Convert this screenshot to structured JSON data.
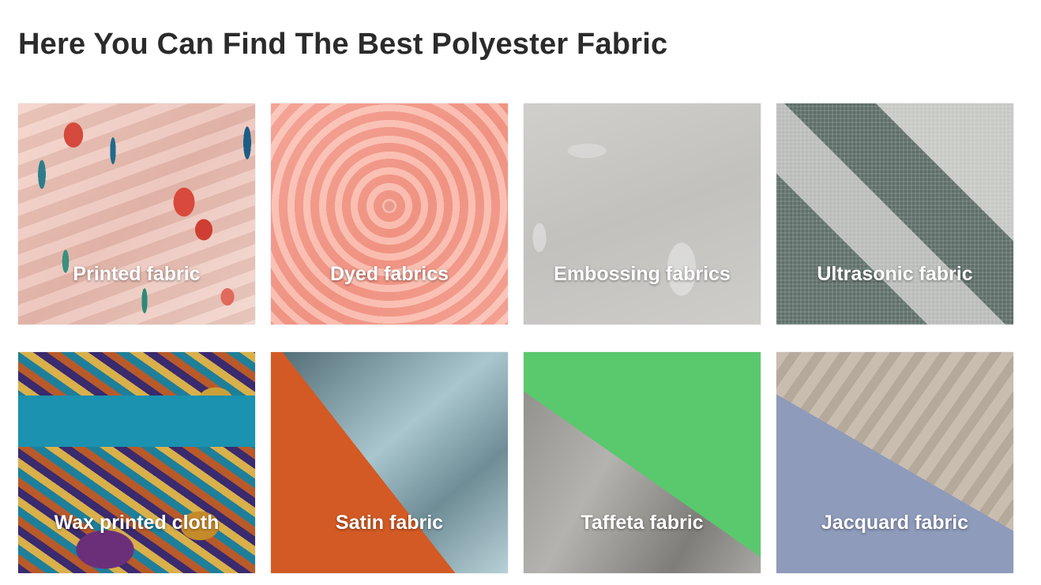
{
  "page_title": "Here You Can Find The Best Polyester Fabric",
  "fabrics": [
    {
      "label": "Printed fabric",
      "icon": "printed-fabric-photo"
    },
    {
      "label": "Dyed fabrics",
      "icon": "dyed-fabric-photo"
    },
    {
      "label": "Embossing fabrics",
      "icon": "embossing-fabric-photo"
    },
    {
      "label": "Ultrasonic fabric",
      "icon": "ultrasonic-fabric-photo"
    },
    {
      "label": "Wax printed cloth",
      "icon": "wax-printed-cloth-photo"
    },
    {
      "label": "Satin fabric",
      "icon": "satin-fabric-photo"
    },
    {
      "label": "Taffeta fabric",
      "icon": "taffeta-fabric-photo"
    },
    {
      "label": "Jacquard fabric",
      "icon": "jacquard-fabric-photo"
    }
  ],
  "colors": {
    "title_text": "#2b2b2b",
    "caption_text": "#ffffff",
    "background": "#ffffff"
  }
}
